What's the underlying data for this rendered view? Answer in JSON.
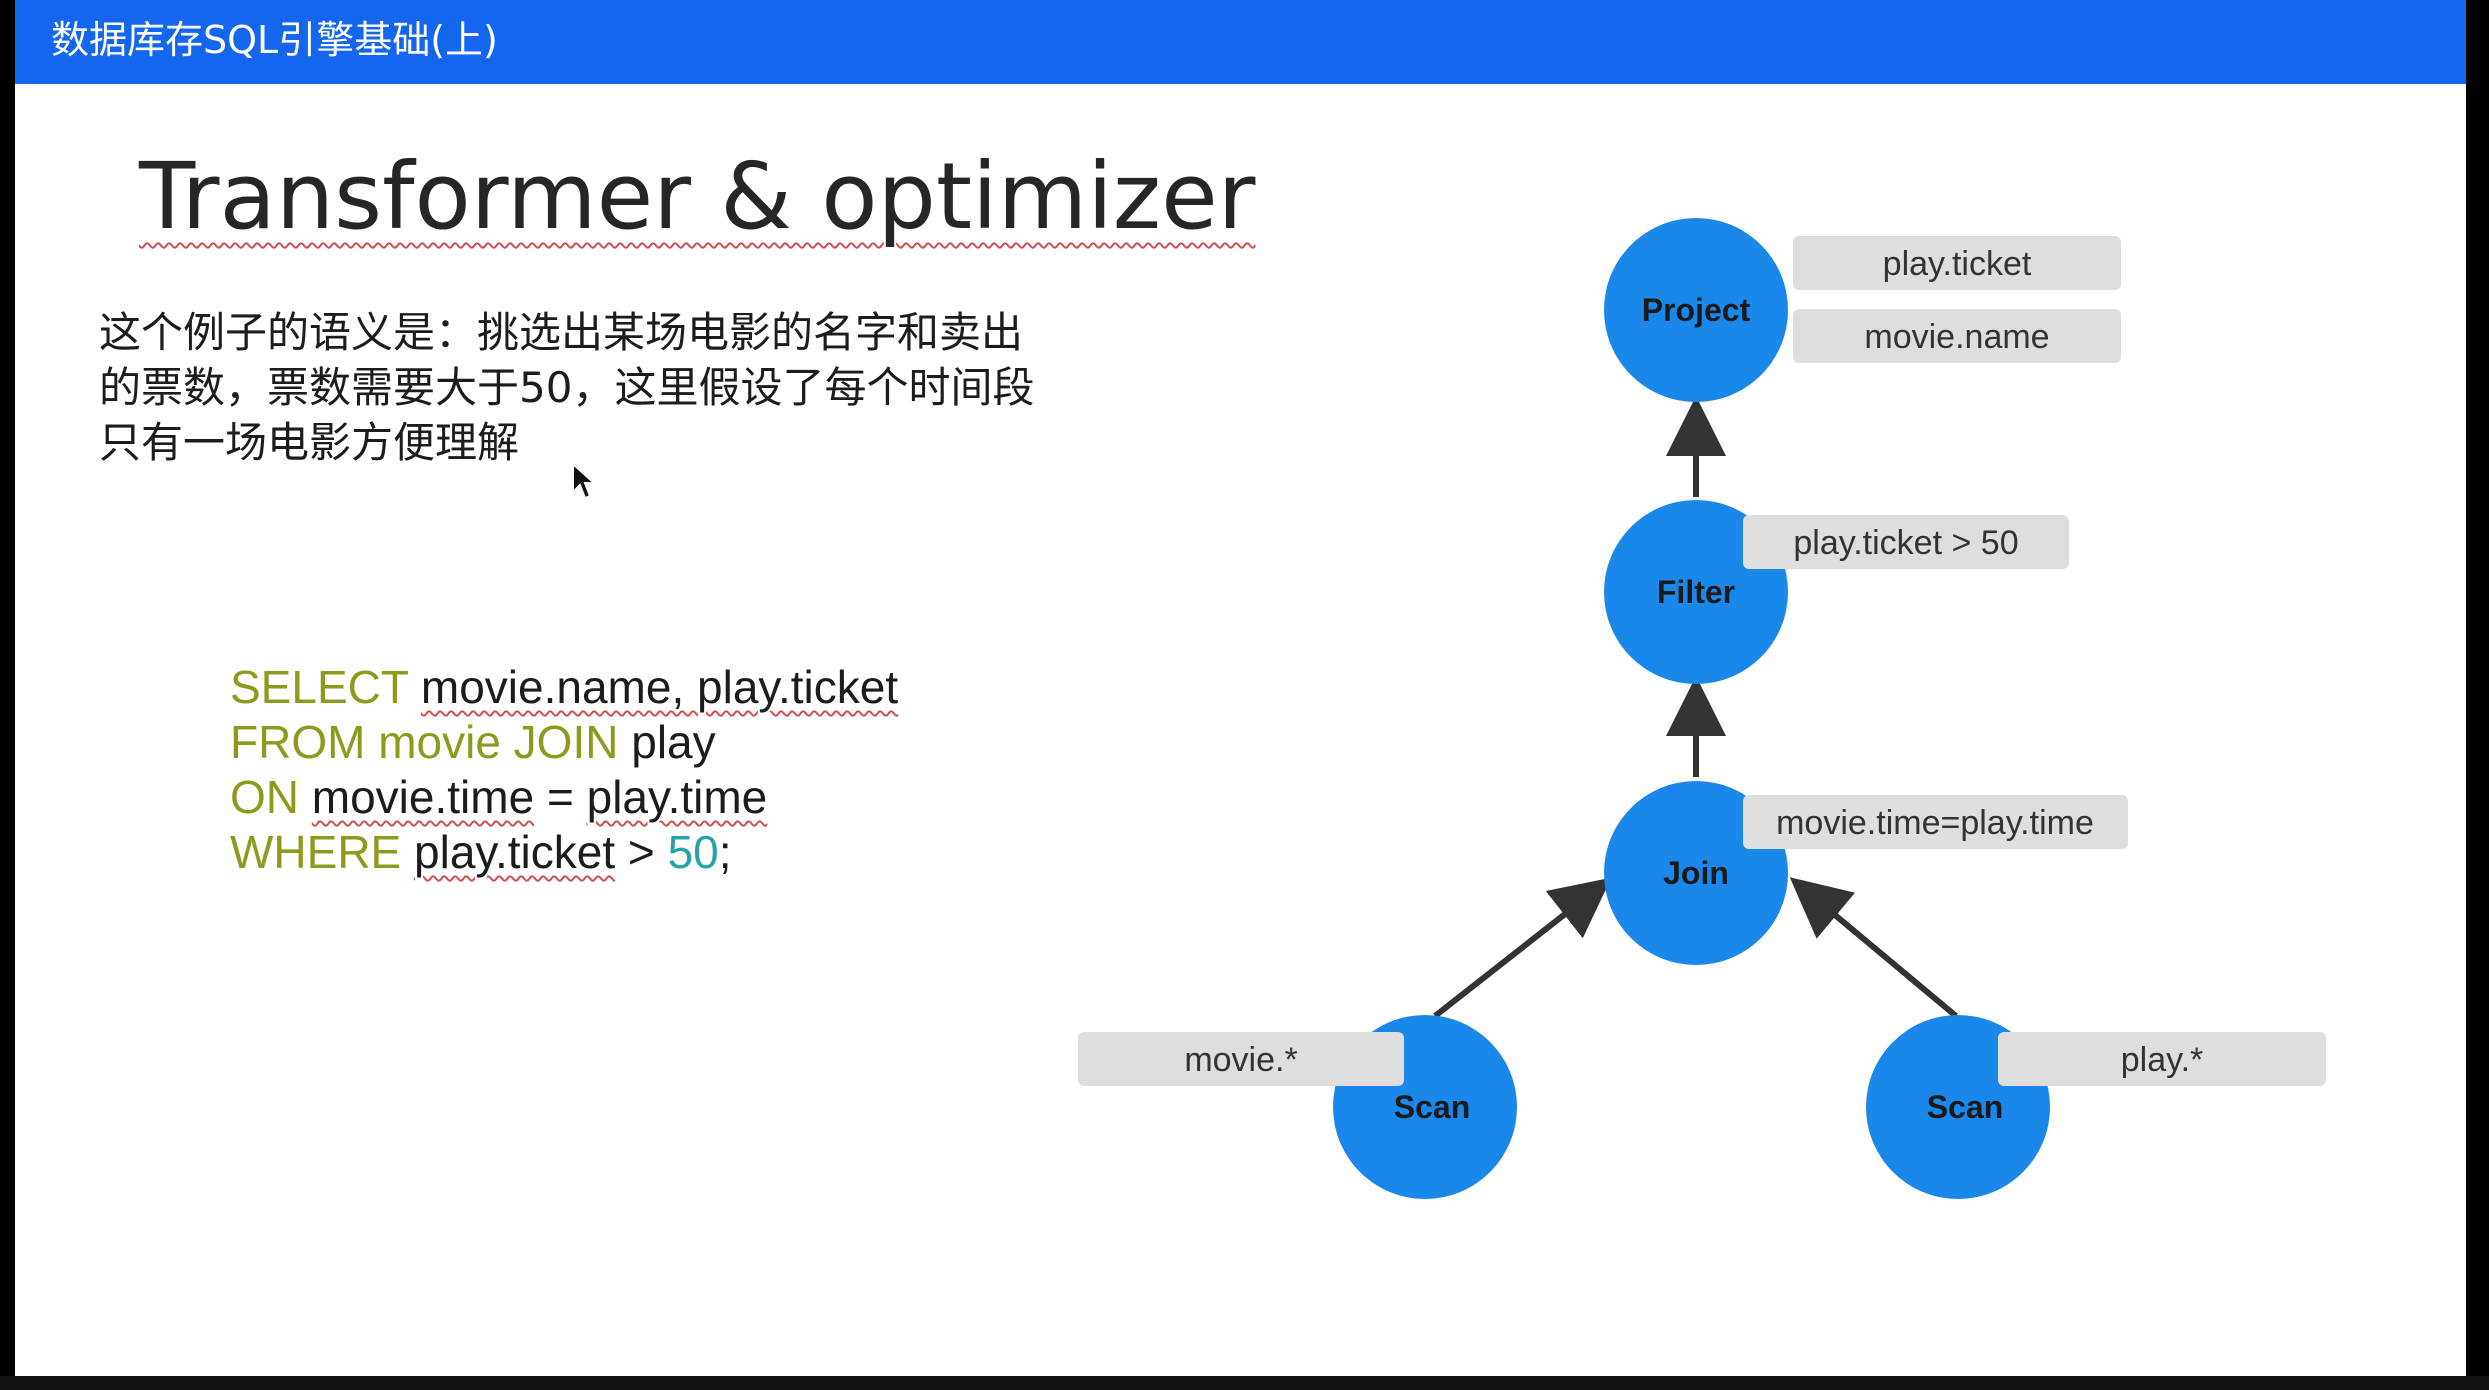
{
  "header": {
    "title": "数据库存SQL引擎基础(上)"
  },
  "slide": {
    "title": "Transformer & optimizer",
    "description": "这个例子的语义是：挑选出某场电影的名字和卖出的票数，票数需要大于50，这里假设了每个时间段只有一场电影方便理解"
  },
  "code": {
    "line1": {
      "kw": "SELECT",
      "text": "movie.name, play.ticket"
    },
    "line2": {
      "kw": "FROM movie JOIN",
      "text": "play"
    },
    "line3": {
      "kw": "ON",
      "lhs": "movie.time",
      "op": "=",
      "rhs": "play.time"
    },
    "line4": {
      "kw": "WHERE",
      "col": "play.ticket",
      "op": ">",
      "num": "50",
      "end": ";"
    }
  },
  "diagram": {
    "nodes": {
      "project": "Project",
      "filter": "Filter",
      "join": "Join",
      "scan_left": "Scan",
      "scan_right": "Scan"
    },
    "labels": {
      "project_1": "play.ticket",
      "project_2": "movie.name",
      "filter": "play.ticket > 50",
      "join": "movie.time=play.time",
      "scan_left": "movie.*",
      "scan_right": "play.*"
    },
    "colors": {
      "node": "#1a87ea",
      "label_bg": "#dedede",
      "edge": "#333333"
    }
  }
}
